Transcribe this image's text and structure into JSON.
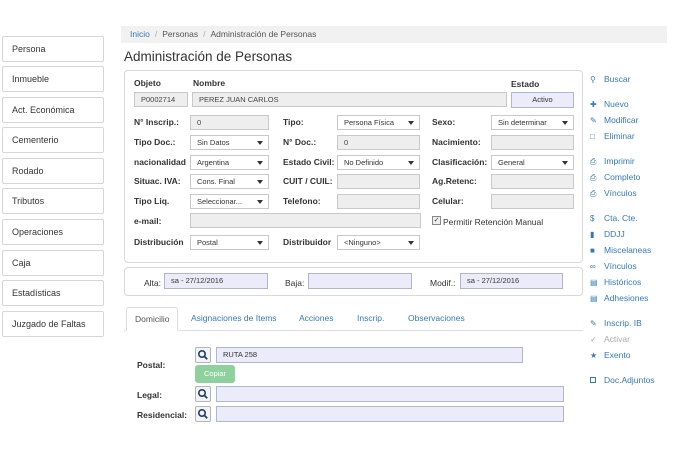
{
  "nav": {
    "items": [
      {
        "label": "Persona"
      },
      {
        "label": "Inmueble"
      },
      {
        "label": "Act. Económica"
      },
      {
        "label": "Cementerio"
      },
      {
        "label": "Rodado"
      },
      {
        "label": "Tributos"
      },
      {
        "label": "Operaciones"
      },
      {
        "label": "Caja"
      },
      {
        "label": "Estadísticas"
      },
      {
        "label": "Juzgado de Faltas"
      }
    ]
  },
  "breadcrumb": {
    "home": "Inicio",
    "level1": "Personas",
    "current": "Administración de Personas"
  },
  "page": {
    "title": "Administración de Personas"
  },
  "form": {
    "objeto_label": "Objeto",
    "objeto_value": "P0002714",
    "nombre_label": "Nombre",
    "nombre_value": "PEREZ JUAN CARLOS",
    "estado_label": "Estado",
    "estado_value": "Activo",
    "ninscrip_label": "N° Inscrip.:",
    "ninscrip_value": "0",
    "tipo_label": "Tipo:",
    "tipo_value": "Persona Física",
    "sexo_label": "Sexo:",
    "sexo_value": "Sin determinar",
    "tipodoc_label": "Tipo Doc.:",
    "tipodoc_value": "Sin Datos",
    "ndoc_label": "N° Doc.:",
    "ndoc_value": "0",
    "nacimiento_label": "Nacimiento:",
    "nacionalidad_label": "nacionalidad",
    "nacionalidad_value": "Argentina",
    "estadocivil_label": "Estado Civil:",
    "estadocivil_value": "No Definido",
    "clasificacion_label": "Clasificación:",
    "clasificacion_value": "General",
    "situaciva_label": "Situac. IVA:",
    "situaciva_value": "Cons. Final",
    "cuit_label": "CUIT / CUIL:",
    "agretenc_label": "Ag.Retenc:",
    "tipoliq_label": "Tipo Liq.",
    "tipoliq_value": "Seleccionar...",
    "telefono_label": "Telefono:",
    "celular_label": "Celular:",
    "email_label": "e-mail:",
    "permitir_label": "Permitir Retención Manual",
    "distribucion_label": "Distribución",
    "distribucion_value": "Postal",
    "distribuidor_label": "Distribuidor",
    "distribuidor_value": "<Ninguno>"
  },
  "audit": {
    "alta_label": "Alta:",
    "alta_value": "sa - 27/12/2016",
    "baja_label": "Baja:",
    "modif_label": "Modif.:",
    "modif_value": "sa - 27/12/2016"
  },
  "tabs": [
    {
      "label": "Domicilio"
    },
    {
      "label": "Asignaciones de Items"
    },
    {
      "label": "Acciones"
    },
    {
      "label": "Inscrip."
    },
    {
      "label": "Observaciones"
    }
  ],
  "domicilio": {
    "postal_label": "Postal:",
    "postal_value": "RUTA 258",
    "copiar_label": "Copiar",
    "legal_label": "Legal:",
    "residencial_label": "Residencial:"
  },
  "actions": {
    "buscar": "Buscar",
    "nuevo": "Nuevo",
    "modificar": "Modificar",
    "eliminar": "Eliminar",
    "imprimir": "Imprimir",
    "completo": "Completo",
    "vinculos": "Vínculos",
    "ctacte": "Cta. Cte.",
    "ddjj": "DDJJ",
    "miscelaneas": "Miscelaneas",
    "vinculos2": "Vínculos",
    "historicos": "Históricos",
    "adhesiones": "Adhesiones",
    "inscripib": "Inscrip. IB",
    "activar": "Activar",
    "exento": "Exento",
    "docadjuntos": "Doc.Adjuntos"
  },
  "colors": {
    "link": "#337ab7",
    "copiar_bg": "#8fd19e",
    "field_lavender": "#ebebfa"
  }
}
